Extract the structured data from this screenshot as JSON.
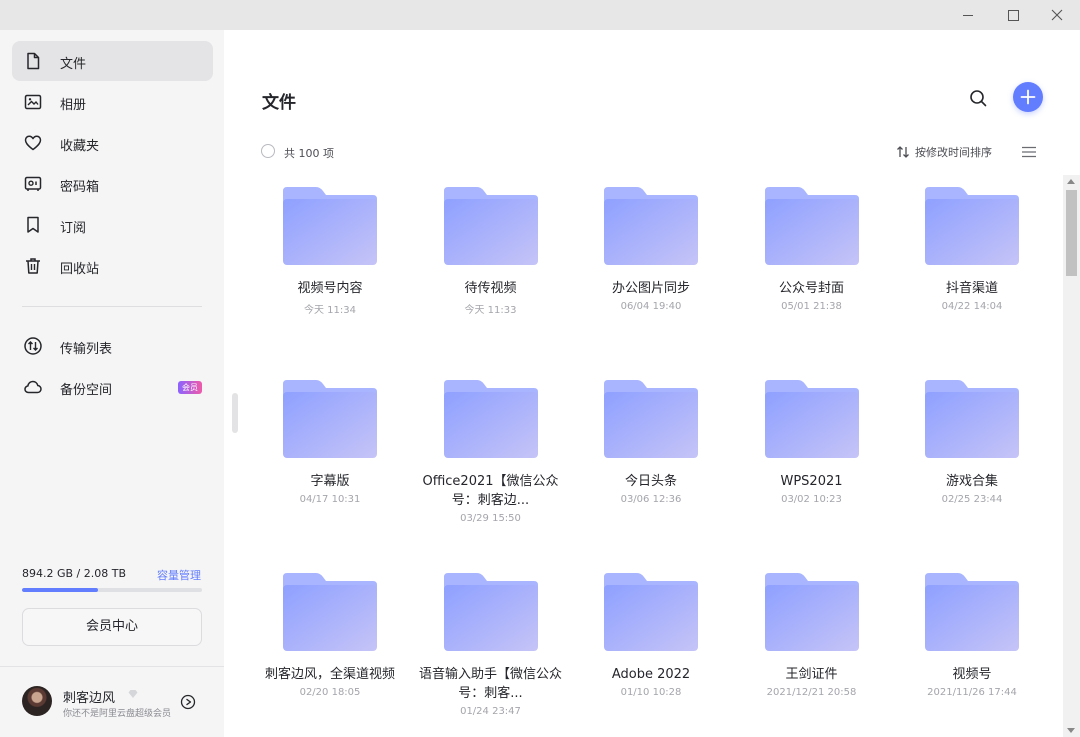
{
  "sidebar": {
    "items": [
      {
        "label": "文件",
        "icon": "file-icon",
        "active": true
      },
      {
        "label": "相册",
        "icon": "album-icon",
        "active": false
      },
      {
        "label": "收藏夹",
        "icon": "heart-icon",
        "active": false
      },
      {
        "label": "密码箱",
        "icon": "safe-icon",
        "active": false
      },
      {
        "label": "订阅",
        "icon": "bookmark-icon",
        "active": false
      },
      {
        "label": "回收站",
        "icon": "trash-icon",
        "active": false
      },
      {
        "label": "传输列表",
        "icon": "transfer-icon",
        "active": false
      },
      {
        "label": "备份空间",
        "icon": "cloud-icon",
        "active": false,
        "badge": "会员"
      }
    ],
    "storage": {
      "text": "894.2 GB / 2.08 TB",
      "used_fraction": 0.42,
      "manage_label": "容量管理"
    },
    "vip_center_label": "会员中心",
    "user": {
      "name": "刺客边风",
      "subtitle": "你还不是阿里云盘超级会员"
    }
  },
  "main": {
    "title": "文件",
    "count_text": "共 100 项",
    "sort_label": "按修改时间排序",
    "folders": [
      {
        "name": "视频号内容",
        "date": "今天 11:34"
      },
      {
        "name": "待传视频",
        "date": "今天 11:33"
      },
      {
        "name": "办公图片同步",
        "date": "06/04 19:40"
      },
      {
        "name": "公众号封面",
        "date": "05/01 21:38"
      },
      {
        "name": "抖音渠道",
        "date": "04/22 14:04"
      },
      {
        "name": "字幕版",
        "date": "04/17 10:31"
      },
      {
        "name": "Office2021【微信公众号：刺客边...",
        "date": "03/29 15:50"
      },
      {
        "name": "今日头条",
        "date": "03/06 12:36"
      },
      {
        "name": "WPS2021",
        "date": "03/02 10:23"
      },
      {
        "name": "游戏合集",
        "date": "02/25 23:44"
      },
      {
        "name": "刺客边风，全渠道视频",
        "date": "02/20 18:05"
      },
      {
        "name": "语音输入助手【微信公众号：刺客...",
        "date": "01/24 23:47"
      },
      {
        "name": "Adobe 2022",
        "date": "01/10 10:28"
      },
      {
        "name": "王剑证件",
        "date": "2021/12/21 20:58"
      },
      {
        "name": "视频号",
        "date": "2021/11/26 17:44"
      }
    ]
  },
  "colors": {
    "accent": "#637dff",
    "folder_top": "#8ea0ff",
    "folder_bottom": "#c6c4f7"
  }
}
